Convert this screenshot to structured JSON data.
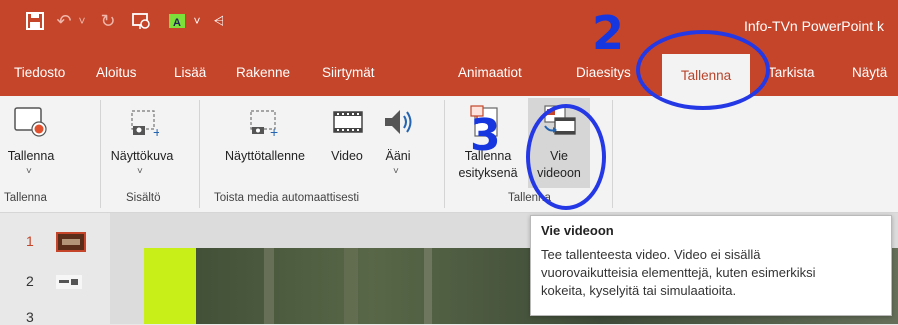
{
  "window": {
    "title": "Info-TVn PowerPoint k"
  },
  "quick_access": [
    {
      "icon": "save-icon",
      "glyph": "🖫"
    },
    {
      "icon": "undo-icon",
      "glyph": "↶"
    },
    {
      "icon": "redo-icon",
      "glyph": "↻"
    },
    {
      "icon": "present-icon",
      "glyph": "⧉"
    },
    {
      "icon": "text-highlight-icon",
      "glyph": "A"
    },
    {
      "icon": "dropdown-icon",
      "glyph": "˅"
    },
    {
      "icon": "customize-icon",
      "glyph": "⩤"
    }
  ],
  "tabs": [
    {
      "label": "Tiedosto"
    },
    {
      "label": "Aloitus"
    },
    {
      "label": "Lisää"
    },
    {
      "label": "Rakenne"
    },
    {
      "label": "Siirtymät"
    },
    {
      "label": "Animaatiot"
    },
    {
      "label": "Diaesitys"
    },
    {
      "label": "Tallenna",
      "active": true
    },
    {
      "label": "Tarkista"
    },
    {
      "label": "Näytä"
    }
  ],
  "ribbon": {
    "buttons": {
      "tallenna": "Tallenna",
      "nayttokuva": "Näyttökuva",
      "nayttotallenne": "Näyttötallenne",
      "video": "Video",
      "aani": "Ääni",
      "tallenna_esityksena_1": "Tallenna",
      "tallenna_esityksena_2": "esityksenä",
      "vie_videoon_1": "Vie",
      "vie_videoon_2": "videoon"
    },
    "groups": {
      "tallenna": "Tallenna",
      "sisalto": "Sisältö",
      "toista": "Toista media automaattisesti",
      "tallenna2": "Tallenna"
    }
  },
  "slides": {
    "numbers": [
      "1",
      "2",
      "3"
    ]
  },
  "tooltip": {
    "title": "Vie videoon",
    "body_lines": [
      "Tee tallenteesta video. Video ei sisällä",
      "vuorovaikutteisia elementtejä, kuten esimerkiksi",
      "kokeita, kyselyitä tai simulaatioita."
    ]
  },
  "annotations": {
    "step2": "2",
    "step3": "3"
  },
  "colors": {
    "accent": "#c4452a",
    "annotation": "#2438e6"
  }
}
